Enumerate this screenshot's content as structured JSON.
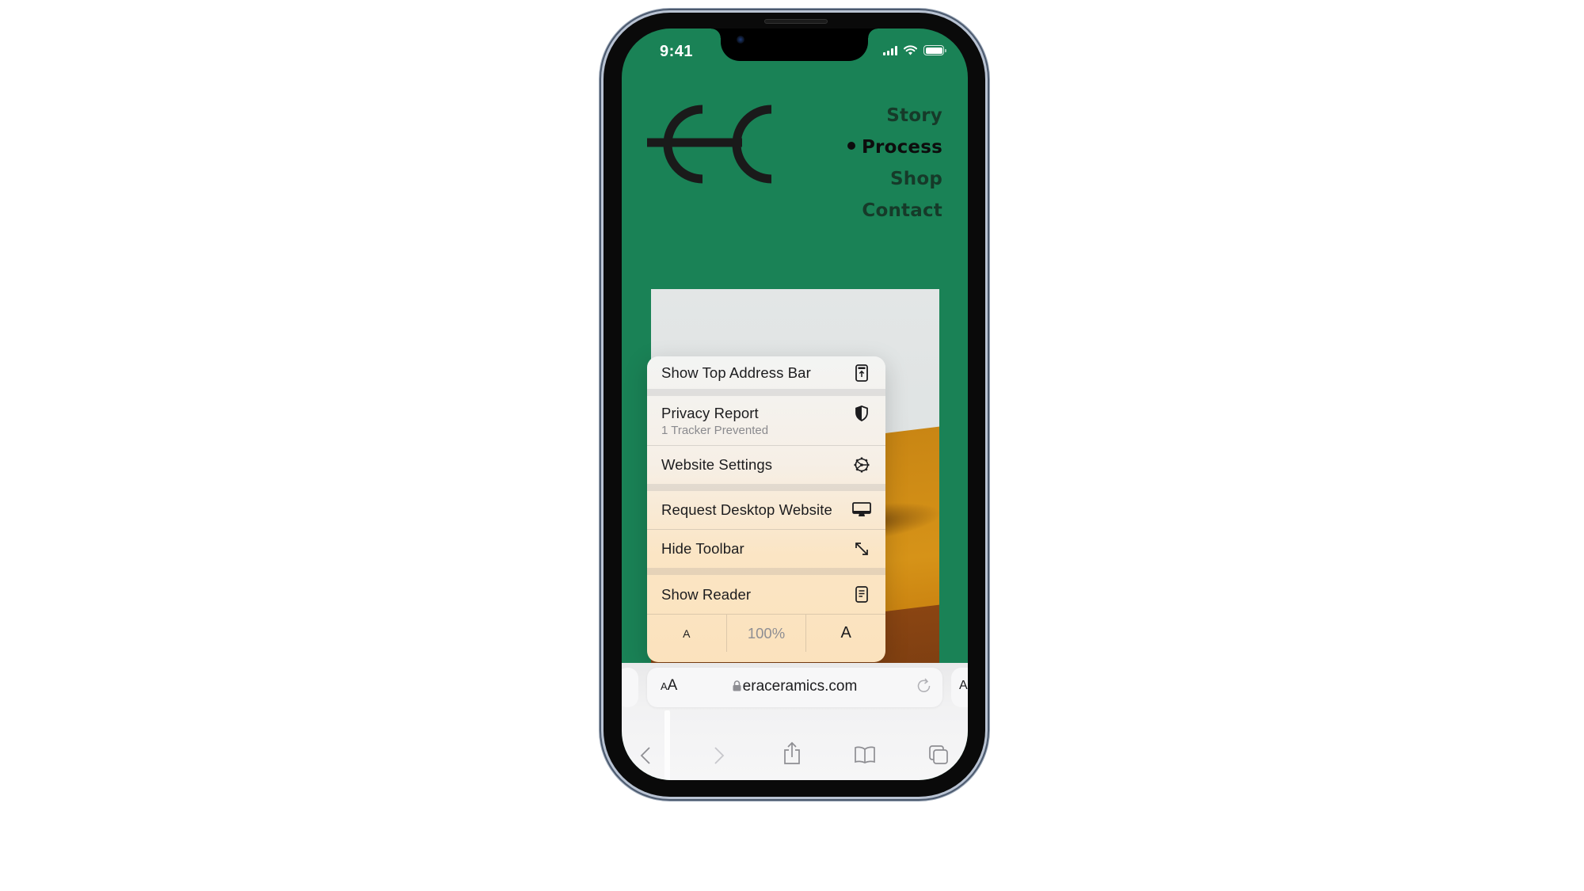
{
  "status_bar": {
    "time": "9:41",
    "icons": [
      "cellular-signal-icon",
      "wifi-icon",
      "battery-icon"
    ]
  },
  "website": {
    "logo_icon": "ec-logo",
    "nav": [
      {
        "label": "Story",
        "active": false
      },
      {
        "label": "Process",
        "active": true
      },
      {
        "label": "Shop",
        "active": false
      },
      {
        "label": "Contact",
        "active": false
      }
    ],
    "colors": {
      "background": "#1a8256",
      "nav_text": "#163a29",
      "nav_active": "#0d0d0d"
    }
  },
  "menu": {
    "items": [
      {
        "label": "Show Top Address Bar",
        "icon": "top-address-bar-icon"
      },
      {
        "label": "Privacy Report",
        "sublabel": "1 Tracker Prevented",
        "icon": "shield-icon"
      },
      {
        "label": "Website Settings",
        "icon": "gear-icon"
      },
      {
        "label": "Request Desktop Website",
        "icon": "desktop-icon"
      },
      {
        "label": "Hide Toolbar",
        "icon": "resize-arrows-icon"
      },
      {
        "label": "Show Reader",
        "icon": "reader-icon"
      }
    ],
    "zoom": {
      "decrease_label": "A",
      "value": "100%",
      "increase_label": "A"
    }
  },
  "address_bar": {
    "aa_label_small": "A",
    "aa_label_large": "A",
    "url": "eraceramics.com",
    "peek_right_label": "A"
  },
  "toolbar": {
    "buttons": [
      "back-icon",
      "forward-icon",
      "share-icon",
      "bookmarks-icon",
      "tabs-icon"
    ]
  }
}
